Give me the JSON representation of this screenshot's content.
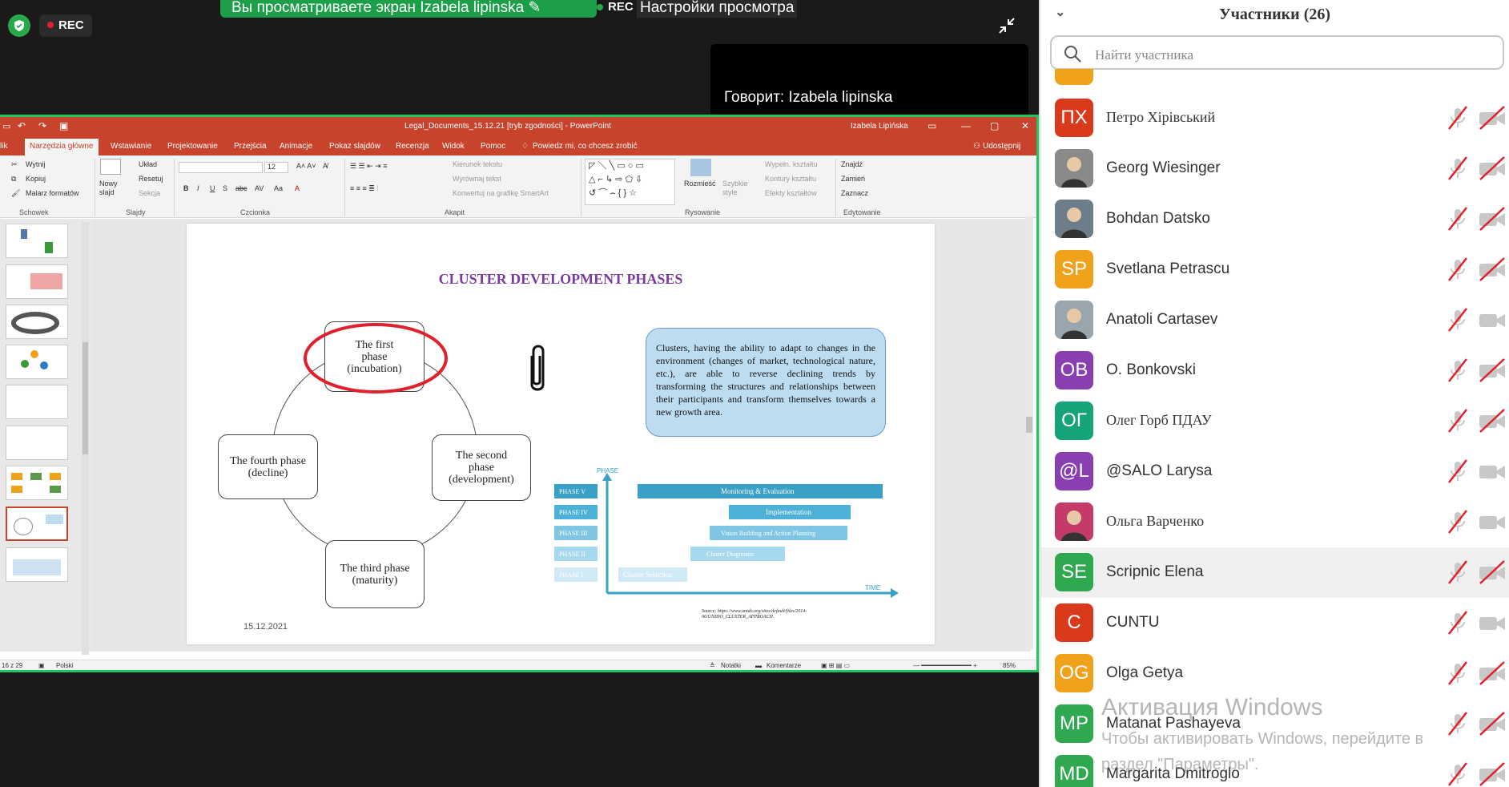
{
  "top_bar": {
    "rec_label": "REC",
    "share_banner": "Вы просматриваете экран Izabela lipinska",
    "rec_small": "REC",
    "view_options": "Настройки просмотра",
    "speaking": "Говорит: Izabela lipinska"
  },
  "ppt": {
    "window_title": "Legal_Documents_15.12.21 [tryb zgodności]  -  PowerPoint",
    "user": "Izabela Lipińska",
    "tabs": [
      "lik",
      "Narzędzia główne",
      "Wstawianie",
      "Projektowanie",
      "Przejścia",
      "Animacje",
      "Pokaz slajdów",
      "Recenzja",
      "Widok",
      "Pomoc"
    ],
    "tell_me": "Powiedz mi, co chcesz zrobić",
    "share": "Udostępnij",
    "ribbon": {
      "cut": "Wytnij",
      "copy": "Kopiuj",
      "format_painter": "Malarz formatów",
      "clipboard_group": "Schowek",
      "new_slide": "Nowy slajd",
      "layout": "Układ",
      "reset": "Resetuj",
      "section": "Sekcja",
      "slides_group": "Slajdy",
      "font_size": "12",
      "font_group": "Czcionka",
      "text_direction": "Kierunek tekstu",
      "align_text": "Wyrównaj tekst",
      "smartart": "Konwertuj na grafikę SmartArt",
      "paragraph_group": "Akapit",
      "arrange": "Rozmieść",
      "quick_styles": "Szybkie style",
      "shape_fill": "Wypełn. kształtu",
      "shape_outline": "Kontury kształtu",
      "shape_effects": "Efekty kształtów",
      "drawing_group": "Rysowanie",
      "find": "Znajdź",
      "replace": "Zamień",
      "select": "Zaznacz",
      "editing_group": "Edytowanie"
    },
    "slide": {
      "title": "CLUSTER DEVELOPMENT PHASES",
      "phase1": "The first phase (incubation)",
      "phase2": "The second phase (development)",
      "phase3": "The third  phase (maturity)",
      "phase4": "The fourth phase (decline)",
      "bubble": "Clusters, having the ability to adapt to changes in the environment (changes of market, technological nature, etc.), are able to reverse declining trends by transforming the structures and relationships between their participants and transform themselves towards a new growth area.",
      "date": "15.12.2021",
      "chart_axis_y": "PHASE",
      "chart_axis_x": "TIME",
      "phase_labels": [
        "PHASE V",
        "PHASE IV",
        "PHASE III",
        "PHASE II",
        "PHASE I"
      ],
      "bar_labels": [
        "Monitoring & Evaluation",
        "Implementation",
        "Vision Building and Action Planning",
        "Cluster Diagnostic",
        "Cluster Selection"
      ],
      "source": "Source: https://www.unido.org/sites/default/files/2014-06/UNIDO_CLUSTER_APPROACH"
    },
    "status": {
      "slide_count": "16 z 29",
      "language": "Polski",
      "notes": "Notatki",
      "comments": "Komentarze",
      "zoom": "85%"
    }
  },
  "participants": {
    "header": "Участники (26)",
    "search_placeholder": "Найти участника",
    "list": [
      {
        "initials": "ПХ",
        "name": "Петро Хірівський",
        "color": "#d93a1c",
        "serif": true,
        "cam_off": true
      },
      {
        "initials": "",
        "name": "Georg Wiesinger",
        "color": "#8a8a8a",
        "serif": false,
        "cam_off": true
      },
      {
        "initials": "",
        "name": "Bohdan Datsko",
        "color": "#6d7d8a",
        "serif": false,
        "cam_off": true
      },
      {
        "initials": "SP",
        "name": "Svetlana Petrascu",
        "color": "#f0a21b",
        "serif": false,
        "cam_off": true
      },
      {
        "initials": "",
        "name": "Anatoli Cartasev",
        "color": "#9aa6ad",
        "serif": false,
        "cam_off": false
      },
      {
        "initials": "OB",
        "name": "O. Bonkovski",
        "color": "#8a3fb0",
        "serif": false,
        "cam_off": true
      },
      {
        "initials": "ОГ",
        "name": "Олег Горб ПДАУ",
        "color": "#17a37a",
        "serif": true,
        "cam_off": true
      },
      {
        "initials": "@L",
        "name": "@SALO Larysa",
        "color": "#8a3fb0",
        "serif": false,
        "cam_off": false
      },
      {
        "initials": "",
        "name": "Ольга Варченко",
        "color": "#c43b6a",
        "serif": true,
        "cam_off": false
      },
      {
        "initials": "SE",
        "name": "Scripnic Elena",
        "color": "#2fa84f",
        "serif": false,
        "cam_off": true
      },
      {
        "initials": "C",
        "name": "CUNTU",
        "color": "#d93a1c",
        "serif": false,
        "cam_off": false
      },
      {
        "initials": "OG",
        "name": "Olga Getya",
        "color": "#f0a21b",
        "serif": false,
        "cam_off": true
      },
      {
        "initials": "MP",
        "name": "Matanat Pashayeva",
        "color": "#2fa84f",
        "serif": false,
        "cam_off": true
      },
      {
        "initials": "MD",
        "name": "Margarita Dmitroglo",
        "color": "#2fa84f",
        "serif": false,
        "cam_off": true
      }
    ]
  },
  "watermark": {
    "line1": "Активация Windows",
    "line2": "Чтобы активировать Windows, перейдите в раздел \"Параметры\"."
  }
}
